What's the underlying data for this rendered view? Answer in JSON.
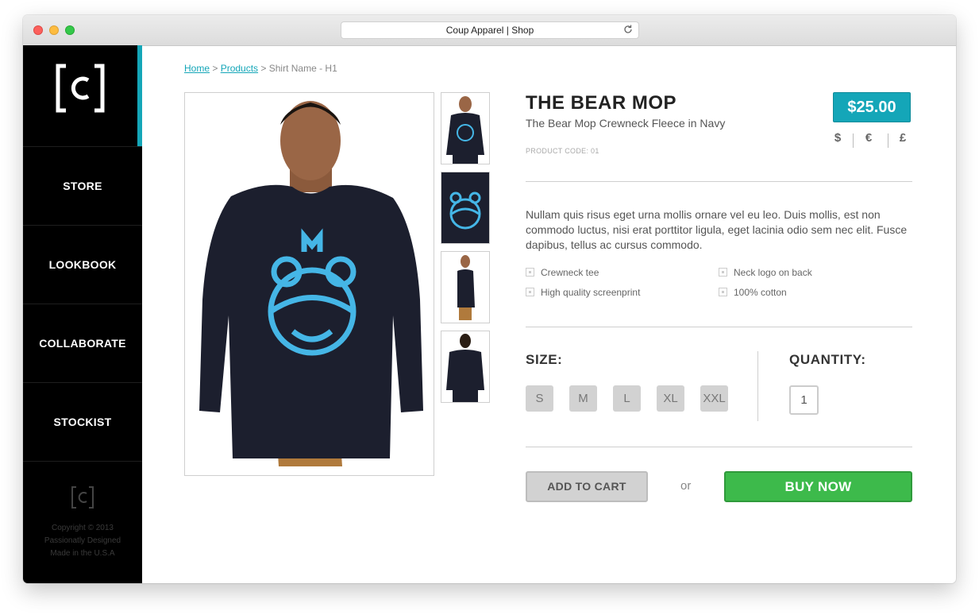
{
  "window": {
    "title": "Coup Apparel | Shop"
  },
  "sidebar": {
    "logo_text": "[C]",
    "items": [
      {
        "label": "STORE"
      },
      {
        "label": "LOOKBOOK"
      },
      {
        "label": "COLLABORATE"
      },
      {
        "label": "STOCKIST"
      }
    ],
    "footer": [
      "Copyright © 2013",
      "Passionatly Designed",
      "Made in the U.S.A"
    ]
  },
  "breadcrumb": {
    "home": "Home",
    "sep1": " > ",
    "products": "Products",
    "sep2": " > ",
    "current": "Shirt Name - H1"
  },
  "product": {
    "title": "THE BEAR MOP",
    "subtitle": "The Bear Mop Crewneck Fleece in Navy",
    "code": "PRODUCT CODE: 01",
    "price": "$25.00",
    "currencies": [
      "$",
      "€",
      "£"
    ],
    "description": "Nullam quis risus eget urna mollis ornare vel eu leo. Duis mollis, est non commodo luctus, nisi erat porttitor ligula, eget lacinia odio sem nec elit. Fusce dapibus, tellus ac cursus commodo.",
    "features": [
      "Crewneck tee",
      "High quality screenprint",
      "Neck logo on back",
      "100% cotton"
    ],
    "size_label": "SIZE:",
    "sizes": [
      "S",
      "M",
      "L",
      "XL",
      "XXL"
    ],
    "quantity_label": "QUANTITY:",
    "quantity": "1",
    "add_to_cart": "ADD TO CART",
    "or": "or",
    "buy_now": "BUY NOW"
  },
  "colors": {
    "accent": "#14a6b8",
    "buy": "#3dba4b",
    "sidebar": "#000000",
    "shirt": "#1c1f2e",
    "print": "#45b6e6"
  }
}
